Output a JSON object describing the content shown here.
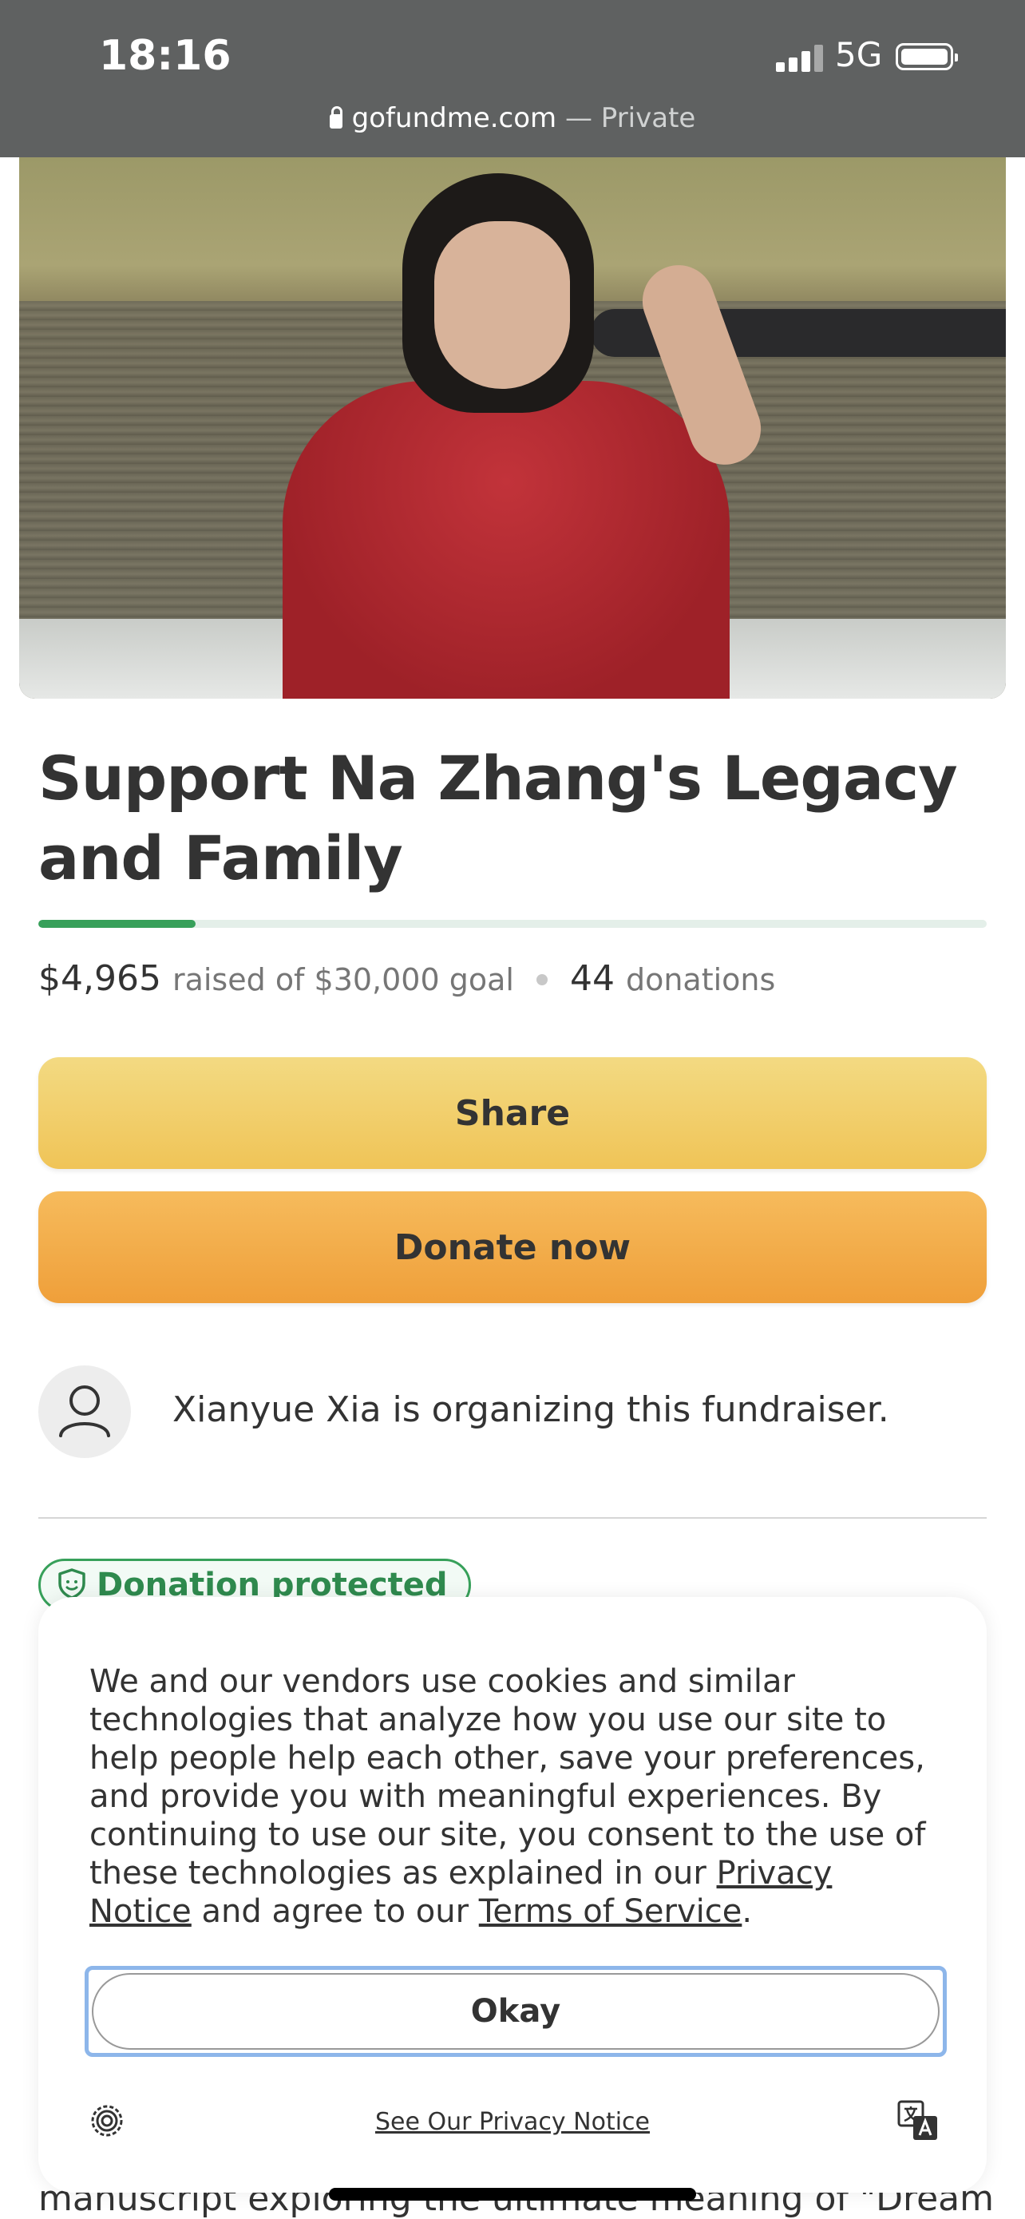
{
  "status_bar": {
    "time": "18:16",
    "network": "5G",
    "url_domain": "gofundme.com",
    "url_suffix": " — Private"
  },
  "campaign": {
    "title": "Support Na Zhang's Legacy and Family",
    "progress_fraction": 0.1655,
    "raised": "$4,965",
    "raised_text": "raised of $30,000 goal",
    "donation_count": "44",
    "donations_label": "donations"
  },
  "actions": {
    "share_label": "Share",
    "donate_label": "Donate now"
  },
  "organizer": {
    "text": "Xianyue Xia is organizing this fundraiser."
  },
  "badge": {
    "label": "Donation protected"
  },
  "partial_text": "manuscript exploring the ultimate meaning of \"Dream",
  "cookie_banner": {
    "text_part1": "We and our vendors use cookies and similar technologies that analyze how you use our site to help people help each other, save your preferences, and provide you with meaningful experiences. By continuing to use our site, you consent to the use of these technologies as explained in our ",
    "privacy_notice_link": "Privacy Notice",
    "text_part2": " and agree to our ",
    "terms_link": "Terms of Service",
    "text_part3": ".",
    "okay_label": "Okay",
    "see_privacy_label": "See Our Privacy Notice"
  },
  "colors": {
    "status_bar_bg": "#5f6161",
    "progress_fill": "#37a05a",
    "share_button": "#f0c457",
    "donate_button": "#ef9f3a",
    "badge_green": "#37a05a",
    "focus_ring": "#8db6ea"
  },
  "icons": [
    "lock-icon",
    "signal-icon",
    "battery-icon",
    "user-icon",
    "shield-icon",
    "privacy-settings-icon",
    "translate-icon"
  ]
}
